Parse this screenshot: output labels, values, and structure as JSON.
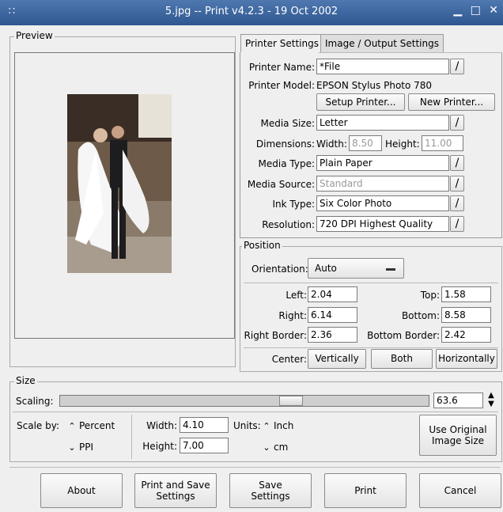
{
  "window": {
    "title": "5.jpg -- Print v4.2.3 - 19 Oct 2002",
    "menu_glyph": "::",
    "minimize_glyph": "▁",
    "maximize_glyph": "□",
    "close_glyph": "✕"
  },
  "preview": {
    "label": "Preview"
  },
  "tabs": {
    "printer_settings": "Printer Settings",
    "image_output": "Image / Output Settings"
  },
  "printer": {
    "name_label": "Printer Name:",
    "name_value": "*File",
    "model_label": "Printer Model:",
    "model_value": "EPSON Stylus Photo 780",
    "setup_button": "Setup Printer...",
    "new_button": "New Printer...",
    "media_size_label": "Media Size:",
    "media_size_value": "Letter",
    "dimensions_label": "Dimensions:",
    "width_label": "Width:",
    "width_value": "8.50",
    "height_label": "Height:",
    "height_value": "11.00",
    "media_type_label": "Media Type:",
    "media_type_value": "Plain Paper",
    "media_source_label": "Media Source:",
    "media_source_value": "Standard",
    "ink_type_label": "Ink Type:",
    "ink_type_value": "Six Color Photo",
    "resolution_label": "Resolution:",
    "resolution_value": "720 DPI Highest Quality",
    "browse_glyph": "/"
  },
  "position": {
    "label": "Position",
    "orientation_label": "Orientation:",
    "orientation_value": "Auto",
    "left_label": "Left:",
    "left_value": "2.04",
    "top_label": "Top:",
    "top_value": "1.58",
    "right_label": "Right:",
    "right_value": "6.14",
    "bottom_label": "Bottom:",
    "bottom_value": "8.58",
    "right_border_label": "Right Border:",
    "right_border_value": "2.36",
    "bottom_border_label": "Bottom Border:",
    "bottom_border_value": "2.42",
    "center_label": "Center:",
    "vertically_button": "Vertically",
    "both_button": "Both",
    "horizontally_button": "Horizontally"
  },
  "size": {
    "label": "Size",
    "scaling_label": "Scaling:",
    "scaling_value": "63.6",
    "scaling_fraction": 0.636,
    "scale_by_label": "Scale by:",
    "percent_label": "Percent",
    "ppi_label": "PPI",
    "width_label": "Width:",
    "width_value": "4.10",
    "height_label": "Height:",
    "height_value": "7.00",
    "units_label": "Units:",
    "inch_label": "Inch",
    "cm_label": "cm",
    "use_original_button": "Use Original Image Size"
  },
  "footer": {
    "about": "About",
    "print_save": "Print and Save Settings",
    "save_settings": "Save Settings",
    "print": "Print",
    "cancel": "Cancel"
  }
}
